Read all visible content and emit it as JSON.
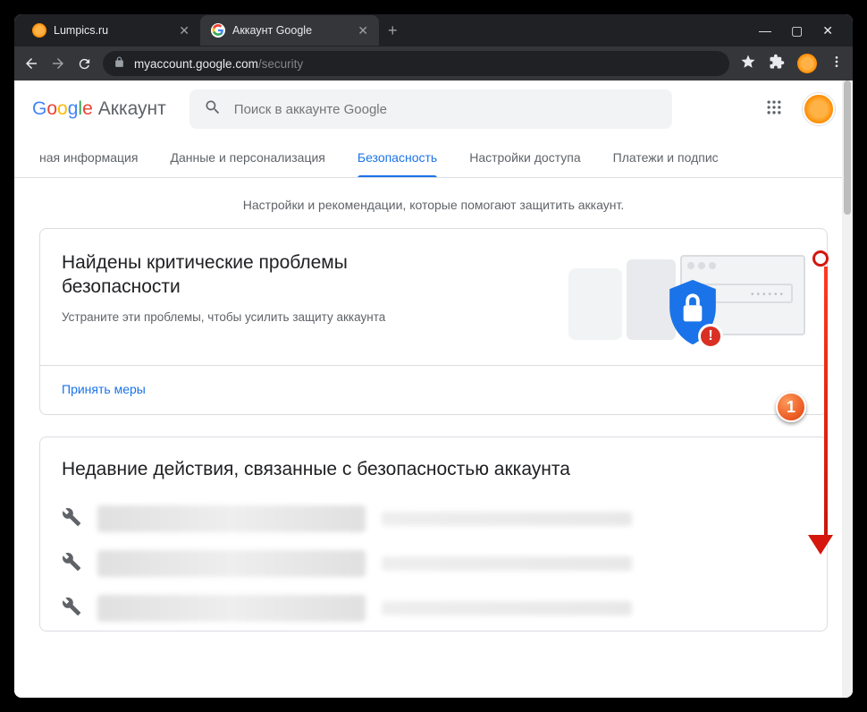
{
  "browser": {
    "tabs": [
      {
        "title": "Lumpics.ru",
        "favicon": "orange"
      },
      {
        "title": "Аккаунт Google",
        "favicon": "google"
      }
    ],
    "newtab": "+",
    "url_host": "myaccount.google.com",
    "url_path": "/security"
  },
  "header": {
    "logo_letters": [
      "G",
      "o",
      "o",
      "g",
      "l",
      "e"
    ],
    "logo_product": "Аккаунт",
    "search_placeholder": "Поиск в аккаунте Google"
  },
  "nav": {
    "items": [
      "ная информация",
      "Данные и персонализация",
      "Безопасность",
      "Настройки доступа",
      "Платежи и подпис"
    ],
    "active_index": 2
  },
  "subtitle": "Настройки и рекомендации, которые помогают защитить аккаунт.",
  "security_card": {
    "title": "Найдены критические проблемы безопасности",
    "desc": "Устраните эти проблемы, чтобы усилить защиту аккаунта",
    "alert_glyph": "!",
    "action": "Принять меры"
  },
  "activity_card": {
    "title": "Недавние действия, связанные с безопасностью аккаунта"
  },
  "annotation": {
    "num": "1"
  }
}
